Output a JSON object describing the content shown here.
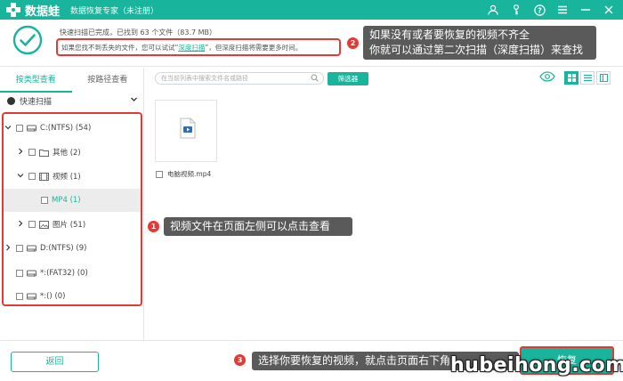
{
  "titlebar": {
    "app_name": "数据蛙",
    "subtitle": "数据恢复专家（未注册）",
    "icons": [
      "user-icon",
      "key-icon",
      "help-icon",
      "menu-icon",
      "minimize-icon",
      "close-icon"
    ]
  },
  "header": {
    "status": "快速扫描已完成，已找到 63 个文件（83.7 MB）",
    "tip_prefix": "如果您找不到丢失的文件，您可以试试“",
    "tip_link": "深度扫描",
    "tip_suffix": "”，但深度扫描将需要更多时间。"
  },
  "callouts": [
    {
      "num": "2",
      "lines": [
        "如果没有或者要恢复的视频不齐全",
        "你就可以通过第二次扫描（深度扫描）来查找"
      ]
    },
    {
      "num": "1",
      "lines": [
        "视频文件在页面左侧可以点击查看"
      ]
    },
    {
      "num": "3",
      "lines": [
        "选择你要恢复的视频，就点击页面右下角"
      ]
    }
  ],
  "left_panel": {
    "tabs": [
      {
        "label": "按类型查看",
        "active": true
      },
      {
        "label": "按路径查看",
        "active": false
      }
    ],
    "quick_scan_label": "快速扫描",
    "tree": [
      {
        "chevron": "down",
        "icon": "drive-icon",
        "label": "C:(NTFS) (54)",
        "indent": 0,
        "selected": false
      },
      {
        "chevron": "right",
        "icon": "folder-icon",
        "label": "其他 (2)",
        "indent": 1,
        "selected": false
      },
      {
        "chevron": "down",
        "icon": "video-icon",
        "label": "视频 (1)",
        "indent": 1,
        "selected": false
      },
      {
        "chevron": "",
        "icon": "",
        "label": "MP4 (1)",
        "indent": 2,
        "selected": true
      },
      {
        "chevron": "right",
        "icon": "image-icon",
        "label": "图片 (51)",
        "indent": 1,
        "selected": false
      },
      {
        "chevron": "right",
        "icon": "drive-icon",
        "label": "D:(NTFS) (9)",
        "indent": 0,
        "selected": false
      },
      {
        "chevron": "",
        "icon": "drive-icon",
        "label": "*:(FAT32) (0)",
        "indent": 0,
        "selected": false
      },
      {
        "chevron": "",
        "icon": "drive-icon",
        "label": "*:() (0)",
        "indent": 0,
        "selected": false
      }
    ]
  },
  "toolbar": {
    "search_placeholder": "在当前列表中搜索文件名或路径",
    "filter_label": "筛选器"
  },
  "files": [
    {
      "name": "电脑视频.mp4",
      "icon": "video-file-icon"
    }
  ],
  "footer": {
    "back_label": "返回",
    "recover_label": "恢复"
  },
  "watermark": "hubeihong.com",
  "colors": {
    "accent": "#18b49c",
    "highlight": "#e53935",
    "callout_bg": "#5a5a5a"
  }
}
